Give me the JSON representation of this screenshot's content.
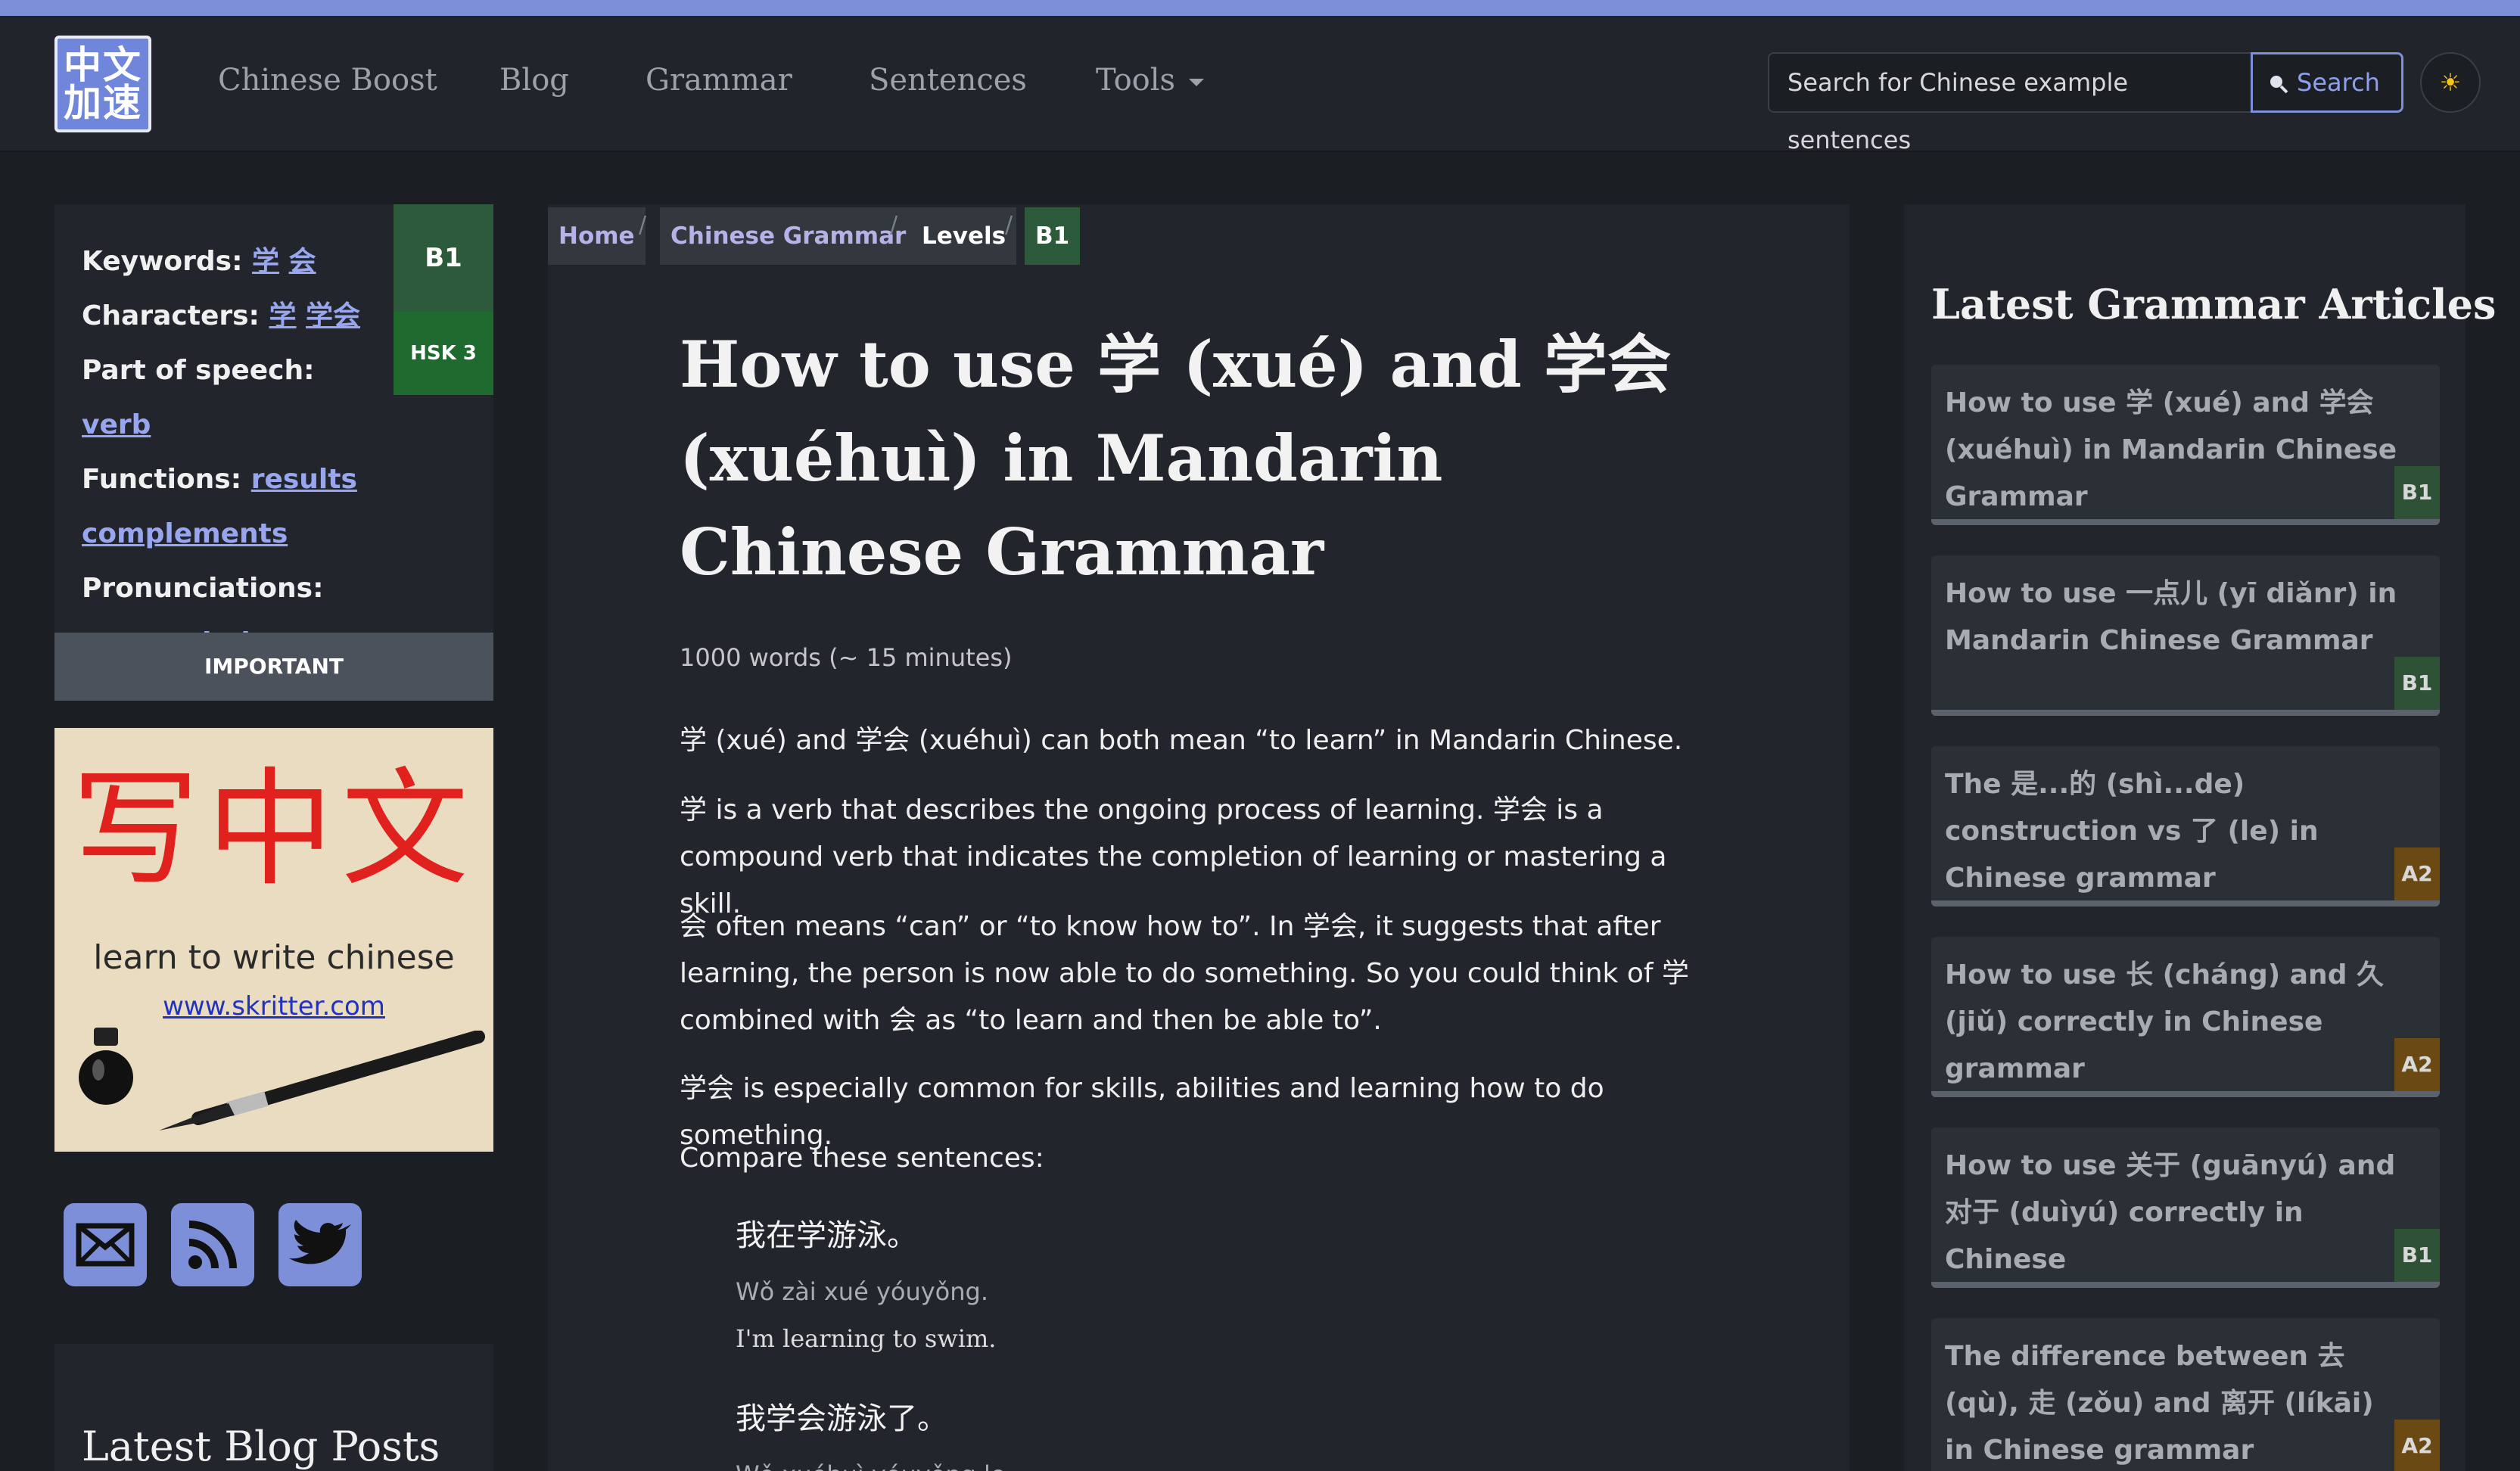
{
  "nav": {
    "logo": "中文加速",
    "links": [
      "Chinese Boost",
      "Blog",
      "Grammar",
      "Sentences"
    ],
    "tools_label": "Tools",
    "search_placeholder": "Search for Chinese example sentences",
    "search_button": "Search",
    "theme_icon": "☀"
  },
  "info": {
    "keywords_label": "Keywords:",
    "keywords": [
      "学",
      "会"
    ],
    "characters_label": "Characters:",
    "characters": [
      "学",
      "学会"
    ],
    "pos_label": "Part of speech:",
    "pos": "verb",
    "functions_label": "Functions:",
    "functions": "results complements",
    "pronunciations_label": "Pronunciations:",
    "pronunciations": [
      "xue",
      "xuehui"
    ],
    "level": "B1",
    "hsk": "HSK 3",
    "important": "IMPORTANT"
  },
  "ad": {
    "chars": "写中文",
    "subtitle": "learn to write chinese",
    "url": "www.skritter.com"
  },
  "social": [
    "email-icon",
    "rss-icon",
    "twitter-icon"
  ],
  "blog": {
    "title": "Latest Blog Posts"
  },
  "breadcrumb": [
    "Home",
    "Chinese Grammar",
    "Levels",
    "B1"
  ],
  "article": {
    "title": "How to use 学 (xué) and 学会 (xuéhuì) in Mandarin Chinese Grammar",
    "meta": "1000 words (~ 15 minutes)",
    "paragraphs": [
      "学 (xué) and 学会 (xuéhuì) can both mean “to learn” in Mandarin Chinese.",
      "学 is a verb that describes the ongoing process of learning. 学会 is a compound verb that indicates the completion of learning or mastering a skill.",
      "会 often means “can” or “to know how to”. In 学会, it suggests that after learning, the person is now able to do something. So you could think of 学 combined with 会 as “to learn and then be able to”.",
      "学会 is especially common for skills, abilities and learning how to do something.",
      "Compare these sentences:"
    ],
    "examples": [
      {
        "zh": "我在学游泳。",
        "py": "Wǒ zài xué yóuyǒng.",
        "en": "I'm learning to swim."
      },
      {
        "zh": "我学会游泳了。",
        "py": "Wǒ xuéhuì yóuyǒng le.",
        "en": ""
      }
    ]
  },
  "sidebar_right": {
    "title": "Latest Grammar Articles",
    "articles": [
      {
        "title": "How to use 学 (xué) and 学会 (xuéhuì) in Mandarin Chinese Grammar",
        "level": "B1"
      },
      {
        "title": "How to use 一点儿 (yī diǎnr) in Mandarin Chinese Grammar",
        "level": "B1"
      },
      {
        "title": "The 是...的 (shì...de) construction vs 了 (le) in Chinese grammar",
        "level": "A2"
      },
      {
        "title": "How to use 长 (cháng) and 久 (jiǔ) correctly in Chinese grammar",
        "level": "A2"
      },
      {
        "title": "How to use 关于 (guānyú) and 对于 (duìyú) correctly in Chinese",
        "level": "B1"
      },
      {
        "title": "The difference between 去 (qù), 走 (zǒu) and 离开 (líkāi) in Chinese grammar",
        "level": "A2"
      }
    ]
  },
  "colors": {
    "accent": "#7d8fd9",
    "b1": "#2d5a3a",
    "a2": "#6a4a12",
    "hsk": "#1f6b2f"
  }
}
